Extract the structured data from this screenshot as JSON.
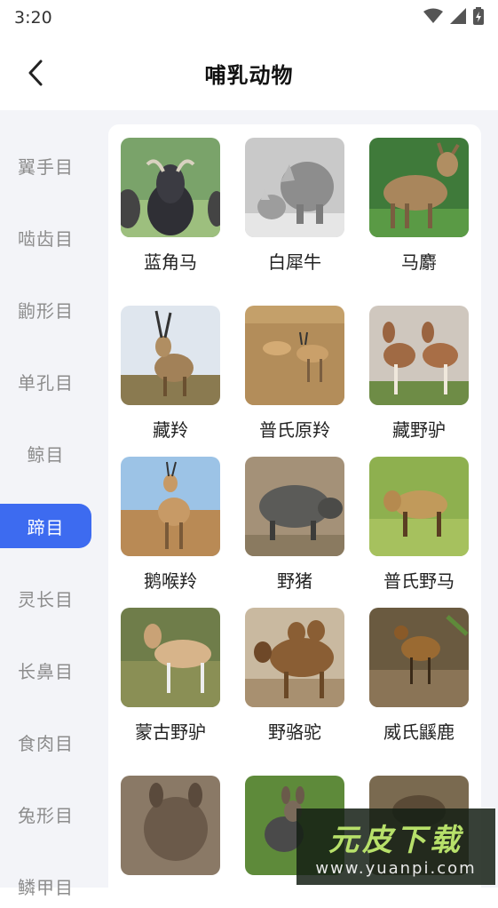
{
  "status_bar": {
    "time": "3:20"
  },
  "header": {
    "title": "哺乳动物"
  },
  "sidebar": {
    "items": [
      {
        "label": "翼手目"
      },
      {
        "label": "啮齿目"
      },
      {
        "label": "鼩形目"
      },
      {
        "label": "单孔目"
      },
      {
        "label": "鲸目"
      },
      {
        "label": "蹄目",
        "active": true
      },
      {
        "label": "灵长目"
      },
      {
        "label": "长鼻目"
      },
      {
        "label": "食肉目"
      },
      {
        "label": "兔形目"
      },
      {
        "label": "鳞甲目"
      }
    ]
  },
  "animals": [
    {
      "label": "蓝角马"
    },
    {
      "label": "白犀牛"
    },
    {
      "label": "马麝"
    },
    {
      "label": "藏羚"
    },
    {
      "label": "普氏原羚"
    },
    {
      "label": "藏野驴"
    },
    {
      "label": "鹅喉羚"
    },
    {
      "label": "野猪"
    },
    {
      "label": "普氏野马"
    },
    {
      "label": "蒙古野驴"
    },
    {
      "label": "野骆驼"
    },
    {
      "label": "威氏鼷鹿"
    },
    {
      "label": ""
    },
    {
      "label": ""
    },
    {
      "label": ""
    }
  ],
  "watermark": {
    "brand": "元皮下载",
    "url": "www.yuanpi.com"
  },
  "colors": {
    "accent": "#3d6bf0",
    "sidebar_bg": "#f3f4f8"
  }
}
